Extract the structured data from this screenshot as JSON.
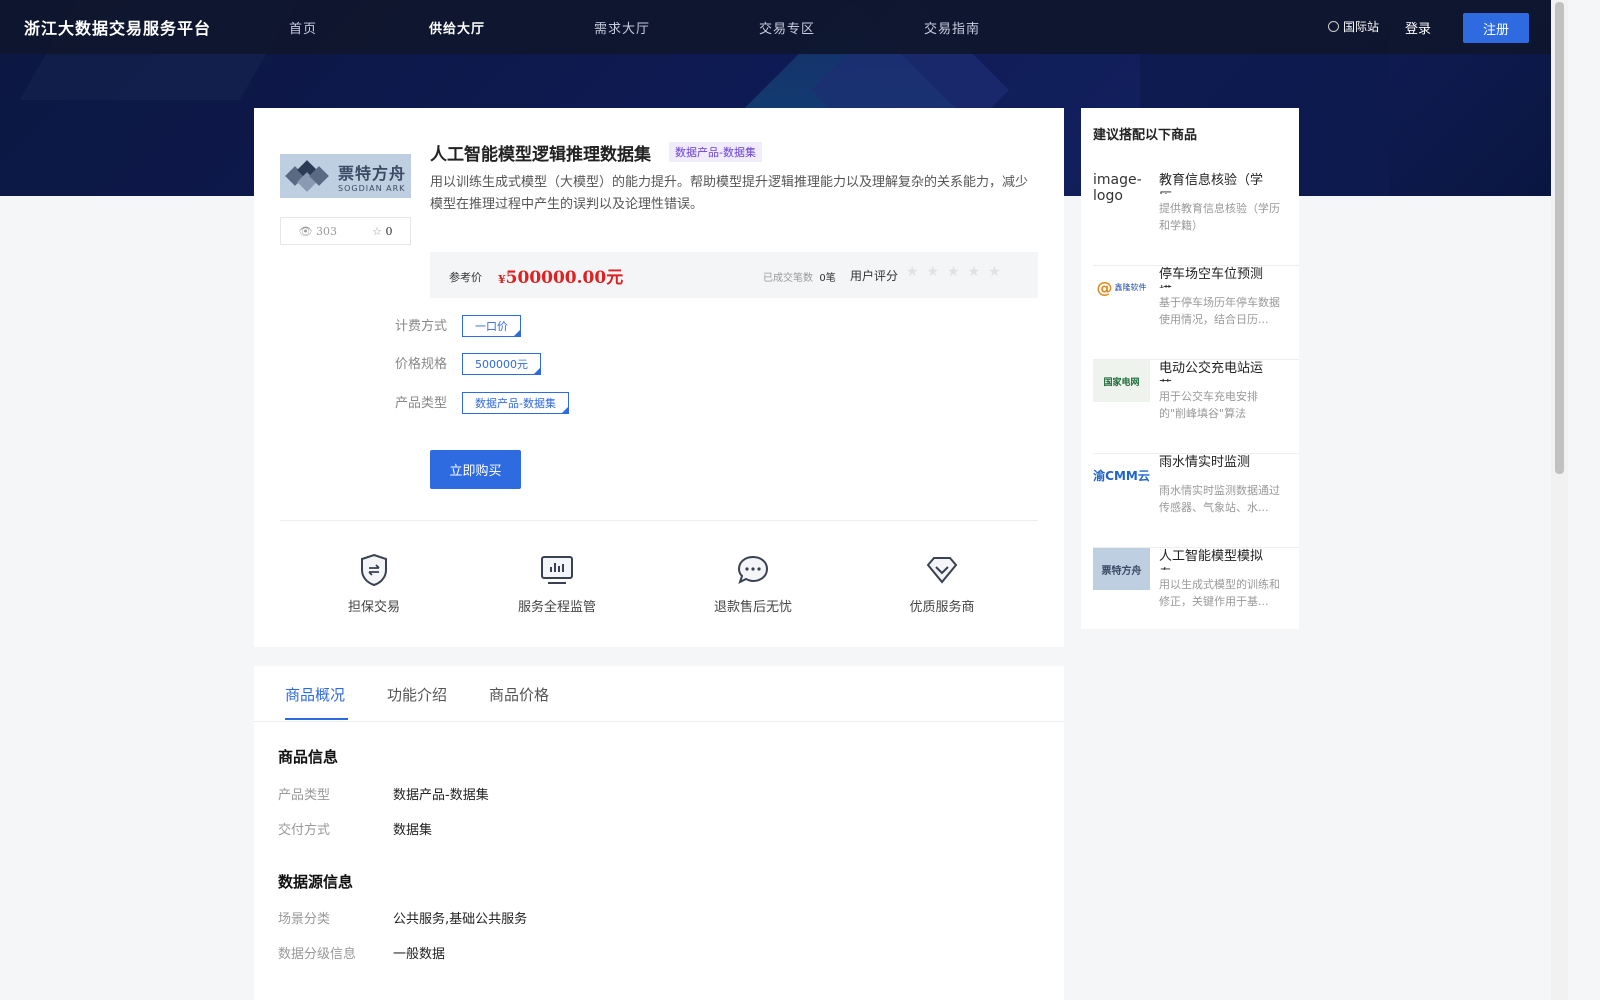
{
  "header": {
    "brand": "浙江大数据交易服务平台",
    "nav": [
      {
        "label": "首页",
        "active": false
      },
      {
        "label": "供给大厅",
        "active": true
      },
      {
        "label": "需求大厅",
        "active": false
      },
      {
        "label": "交易专区",
        "active": false
      },
      {
        "label": "交易指南",
        "active": false
      }
    ],
    "intl": "国际站",
    "login": "登录",
    "register": "注册"
  },
  "product": {
    "logo_cn": "票特方舟",
    "logo_en": "SOGDIAN ARK",
    "views": "303",
    "favorites": "0",
    "title": "人工智能模型逻辑推理数据集",
    "tag": "数据产品-数据集",
    "description": "用以训练生成式模型（大模型）的能力提升。帮助模型提升逻辑推理能力以及理解复杂的关系能力，减少模型在推理过程中产生的误判以及论理性错误。",
    "price_label": "参考价",
    "currency_symbol": "¥",
    "price": "500000.00元",
    "deal_label": "已成交笔数",
    "deal_count": "0笔",
    "rating_label": "用户评分",
    "rating_stars": "★★★★★",
    "rating_value": 0,
    "options": [
      {
        "label": "计费方式",
        "value": "一口价"
      },
      {
        "label": "价格规格",
        "value": "500000元"
      },
      {
        "label": "产品类型",
        "value": "数据产品-数据集"
      }
    ],
    "buy_label": "立即购买",
    "features": [
      {
        "label": "担保交易",
        "icon": "shield-exchange-icon"
      },
      {
        "label": "服务全程监管",
        "icon": "monitor-chart-icon"
      },
      {
        "label": "退款售后无忧",
        "icon": "chat-bubble-icon"
      },
      {
        "label": "优质服务商",
        "icon": "diamond-icon"
      }
    ]
  },
  "recommend": {
    "title": "建议搭配以下商品",
    "items": [
      {
        "thumb": "image-logo",
        "name": "教育信息核验（学历...",
        "desc": "提供教育信息核验（学历和学籍）"
      },
      {
        "thumb": "鑫隆软件",
        "name": "停车场空车位预测模...",
        "desc": "基于停车场历年停车数据使用情况，结合日历..."
      },
      {
        "thumb": "国家电网",
        "name": "电动公交充电站运营...",
        "desc": "用于公交车充电安排的\"削峰填谷\"算法"
      },
      {
        "thumb": "渝CMM云",
        "name": "雨水情实时监测",
        "desc": "雨水情实时监测数据通过传感器、气象站、水..."
      },
      {
        "thumb": "票特方舟",
        "name": "人工智能模型模拟专...",
        "desc": "用以生成式模型的训练和修正，关键作用于基..."
      }
    ]
  },
  "tabs": {
    "items": [
      "商品概况",
      "功能介绍",
      "商品价格"
    ],
    "active": 0
  },
  "overview": {
    "section1_title": "商品信息",
    "section1": [
      {
        "k": "产品类型",
        "v": "数据产品-数据集"
      },
      {
        "k": "交付方式",
        "v": "数据集"
      }
    ],
    "section2_title": "数据源信息",
    "section2": [
      {
        "k": "场景分类",
        "v": "公共服务,基础公共服务"
      },
      {
        "k": "数据分级信息",
        "v": "一般数据"
      }
    ]
  }
}
